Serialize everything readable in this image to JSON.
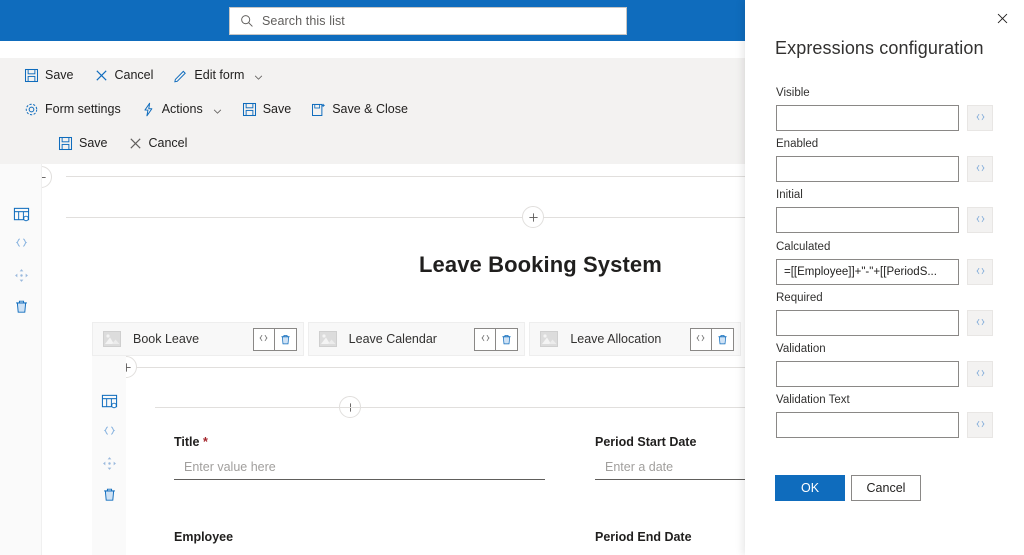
{
  "search": {
    "placeholder": "Search this list",
    "icon": "search-icon"
  },
  "command_bar": {
    "row1": [
      {
        "label": "Save",
        "icon": "save-icon"
      },
      {
        "label": "Cancel",
        "icon": "close-icon"
      },
      {
        "label": "Edit form",
        "icon": "pencil-icon",
        "chevron": true
      }
    ],
    "row2": [
      {
        "label": "Form settings",
        "icon": "gear-icon"
      },
      {
        "label": "Actions",
        "icon": "lightning-icon",
        "chevron": true
      },
      {
        "label": "Save",
        "icon": "save-icon"
      },
      {
        "label": "Save & Close",
        "icon": "save-close-icon"
      }
    ],
    "row3": [
      {
        "label": "Save",
        "icon": "save-icon"
      },
      {
        "label": "Cancel",
        "icon": "close-icon"
      }
    ]
  },
  "rail": {
    "outer": [
      {
        "icon": "form-settings-icon"
      },
      {
        "icon": "expression-braces-icon"
      },
      {
        "icon": "move-icon"
      },
      {
        "icon": "delete-trash-icon"
      }
    ],
    "inner": [
      {
        "icon": "form-settings-icon"
      },
      {
        "icon": "expression-braces-icon"
      },
      {
        "icon": "move-icon"
      },
      {
        "icon": "delete-trash-icon"
      }
    ]
  },
  "canvas": {
    "form_title": "Leave Booking System",
    "add_button_icon": "plus-icon",
    "tabs": [
      {
        "label": "Book Leave",
        "image_icon": "image-placeholder-icon",
        "expr_icon": "expression-braces-icon",
        "delete_icon": "delete-trash-icon"
      },
      {
        "label": "Leave Calendar",
        "image_icon": "image-placeholder-icon",
        "expr_icon": "expression-braces-icon",
        "delete_icon": "delete-trash-icon"
      },
      {
        "label": "Leave Allocation",
        "image_icon": "image-placeholder-icon",
        "expr_icon": "expression-braces-icon",
        "delete_icon": "delete-trash-icon"
      }
    ],
    "fields": {
      "title": {
        "label": "Title",
        "required_marker": "*",
        "placeholder": "Enter value here"
      },
      "period_start_date": {
        "label": "Period Start Date",
        "placeholder": "Enter a date"
      },
      "employee": {
        "label": "Employee"
      },
      "period_end_date": {
        "label": "Period End Date"
      }
    }
  },
  "panel": {
    "title": "Expressions configuration",
    "close_icon": "close-icon",
    "expression_button_icon": "expression-braces-icon",
    "fields": [
      {
        "label": "Visible",
        "value": ""
      },
      {
        "label": "Enabled",
        "value": ""
      },
      {
        "label": "Initial",
        "value": ""
      },
      {
        "label": "Calculated",
        "value": "=[[Employee]]+\"-\"+[[PeriodS..."
      },
      {
        "label": "Required",
        "value": ""
      },
      {
        "label": "Validation",
        "value": ""
      },
      {
        "label": "Validation Text",
        "value": ""
      }
    ],
    "ok_label": "OK",
    "cancel_label": "Cancel"
  },
  "colors": {
    "brand_blue": "#0f6cbd",
    "command_bar_bg": "#f3f2f1",
    "required_red": "#a4262c",
    "panel_bg": "#ffffff"
  }
}
